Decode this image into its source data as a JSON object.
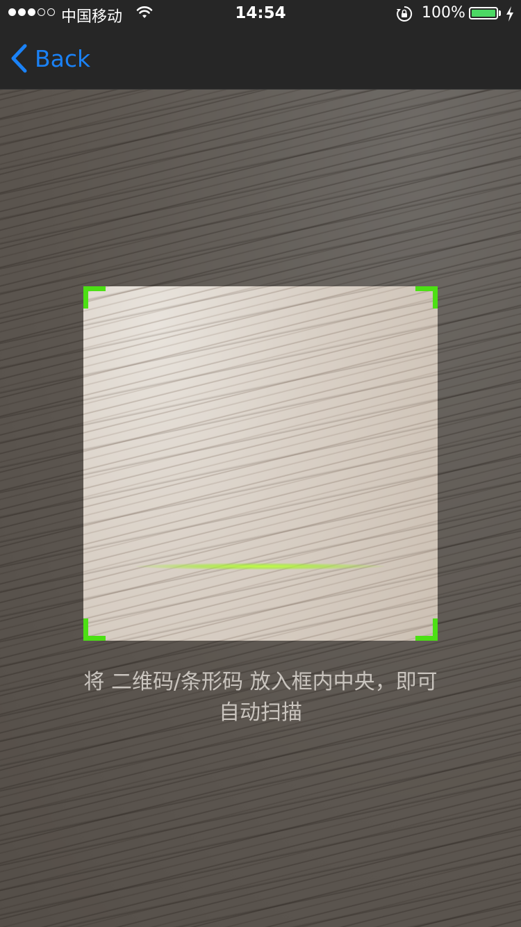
{
  "status_bar": {
    "signal_bars": 3,
    "signal_total": 5,
    "carrier": "中国移动",
    "time": "14:54",
    "battery_percent": "100%",
    "battery_level": 1.0,
    "icons": [
      "wifi-icon",
      "orientation-lock-icon",
      "battery-icon",
      "charging-bolt-icon"
    ]
  },
  "nav": {
    "back_label": "Back",
    "back_icon": "chevron-left-icon"
  },
  "scanner": {
    "hint": "将 二维码/条形码 放入框内中央，即可自动扫描",
    "frame_color": "#4ce014",
    "scan_line_color": "#b4ff32"
  },
  "colors": {
    "bar_background": "#262626",
    "accent": "#1a82f7",
    "battery_green": "#4cd964"
  }
}
